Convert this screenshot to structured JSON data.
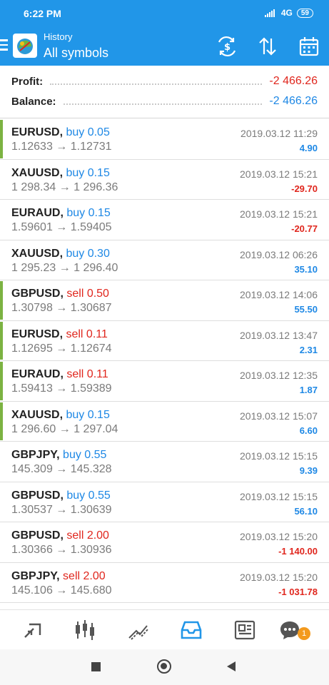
{
  "status_bar": {
    "time": "6:22 PM",
    "network": "4G",
    "battery": "59"
  },
  "app_bar": {
    "subtitle": "History",
    "title": "All symbols"
  },
  "summary": {
    "profit_label": "Profit:",
    "profit_value": "-2 466.26",
    "balance_label": "Balance:",
    "balance_value": "-2 466.26"
  },
  "trades": [
    {
      "symbol": "EURUSD,",
      "side": "buy 0.05",
      "prices": "1.12633 → 1.12731",
      "time": "2019.03.12 11:29",
      "profit": "4.90",
      "side_color": "#1e88e5",
      "profit_color": "#1e88e5",
      "marked": true
    },
    {
      "symbol": "XAUUSD,",
      "side": "buy 0.15",
      "prices": "1 298.34 → 1 296.36",
      "time": "2019.03.12 15:21",
      "profit": "-29.70",
      "side_color": "#1e88e5",
      "profit_color": "#e0261d",
      "marked": false
    },
    {
      "symbol": "EURAUD,",
      "side": "buy 0.15",
      "prices": "1.59601 → 1.59405",
      "time": "2019.03.12 15:21",
      "profit": "-20.77",
      "side_color": "#1e88e5",
      "profit_color": "#e0261d",
      "marked": false
    },
    {
      "symbol": "XAUUSD,",
      "side": "buy 0.30",
      "prices": "1 295.23 → 1 296.40",
      "time": "2019.03.12 06:26",
      "profit": "35.10",
      "side_color": "#1e88e5",
      "profit_color": "#1e88e5",
      "marked": false
    },
    {
      "symbol": "GBPUSD,",
      "side": "sell 0.50",
      "prices": "1.30798 → 1.30687",
      "time": "2019.03.12 14:06",
      "profit": "55.50",
      "side_color": "#e0261d",
      "profit_color": "#1e88e5",
      "marked": true
    },
    {
      "symbol": "EURUSD,",
      "side": "sell 0.11",
      "prices": "1.12695 → 1.12674",
      "time": "2019.03.12 13:47",
      "profit": "2.31",
      "side_color": "#e0261d",
      "profit_color": "#1e88e5",
      "marked": true
    },
    {
      "symbol": "EURAUD,",
      "side": "sell 0.11",
      "prices": "1.59413 → 1.59389",
      "time": "2019.03.12 12:35",
      "profit": "1.87",
      "side_color": "#e0261d",
      "profit_color": "#1e88e5",
      "marked": true
    },
    {
      "symbol": "XAUUSD,",
      "side": "buy 0.15",
      "prices": "1 296.60 → 1 297.04",
      "time": "2019.03.12 15:07",
      "profit": "6.60",
      "side_color": "#1e88e5",
      "profit_color": "#1e88e5",
      "marked": true
    },
    {
      "symbol": "GBPJPY,",
      "side": "buy 0.55",
      "prices": "145.309 → 145.328",
      "time": "2019.03.12 15:15",
      "profit": "9.39",
      "side_color": "#1e88e5",
      "profit_color": "#1e88e5",
      "marked": false
    },
    {
      "symbol": "GBPUSD,",
      "side": "buy 0.55",
      "prices": "1.30537 → 1.30639",
      "time": "2019.03.12 15:15",
      "profit": "56.10",
      "side_color": "#1e88e5",
      "profit_color": "#1e88e5",
      "marked": false
    },
    {
      "symbol": "GBPUSD,",
      "side": "sell 2.00",
      "prices": "1.30366 → 1.30936",
      "time": "2019.03.12 15:20",
      "profit": "-1 140.00",
      "side_color": "#e0261d",
      "profit_color": "#e0261d",
      "marked": false
    },
    {
      "symbol": "GBPJPY,",
      "side": "sell 2.00",
      "prices": "145.106 → 145.680",
      "time": "2019.03.12 15:20",
      "profit": "-1 031.78",
      "side_color": "#e0261d",
      "profit_color": "#e0261d",
      "marked": false
    }
  ],
  "bottom_nav": [
    {
      "icon": "quotes-icon"
    },
    {
      "icon": "chart-icon"
    },
    {
      "icon": "trade-icon"
    },
    {
      "icon": "history-icon",
      "active": true
    },
    {
      "icon": "news-icon"
    },
    {
      "icon": "chat-icon",
      "badge": "1"
    }
  ],
  "colors": {
    "accent": "#2196e8",
    "buy": "#1e88e5",
    "sell": "#e0261d",
    "marker": "#7cb342",
    "badge": "#f39a1e"
  }
}
